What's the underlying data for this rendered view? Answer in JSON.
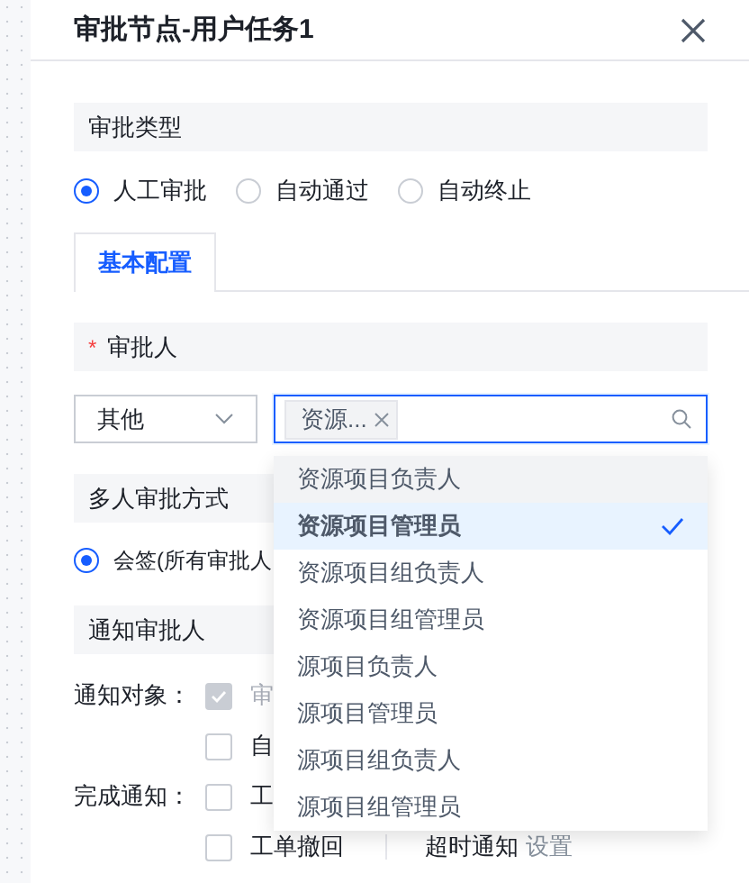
{
  "dialog": {
    "title": "审批节点-用户任务1"
  },
  "approval_type": {
    "label": "审批类型",
    "options": [
      {
        "label": "人工审批",
        "selected": true
      },
      {
        "label": "自动通过",
        "selected": false
      },
      {
        "label": "自动终止",
        "selected": false
      }
    ]
  },
  "tabs": [
    {
      "label": "基本配置",
      "selected": true
    }
  ],
  "approver": {
    "label": "审批人",
    "required_mark": "*",
    "type_select": {
      "value": "其他"
    },
    "picker": {
      "focused": true,
      "tags": [
        "资源..."
      ]
    }
  },
  "multi_approval": {
    "label": "多人审批方式",
    "options": [
      {
        "label": "会签(所有审批人",
        "selected": true
      }
    ]
  },
  "notify": {
    "label": "通知审批人",
    "rows": [
      {
        "label": "通知对象：",
        "checkboxes": [
          {
            "label": "审",
            "checked": true,
            "disabled": true
          }
        ]
      },
      {
        "checkboxes": [
          {
            "label": "自",
            "checked": false,
            "disabled": false
          }
        ]
      },
      {
        "label": "完成通知：",
        "checkboxes": [
          {
            "label": "工",
            "checked": false,
            "disabled": false
          }
        ]
      },
      {
        "checkboxes": [
          {
            "label": "工单撤回",
            "checked": false,
            "disabled": false
          }
        ],
        "extra": "超时通知",
        "link": "设置"
      }
    ]
  },
  "dropdown": {
    "items": [
      {
        "label": "资源项目负责人",
        "selected": false,
        "hovered": true
      },
      {
        "label": "资源项目管理员",
        "selected": true,
        "hovered": false
      },
      {
        "label": "资源项目组负责人",
        "selected": false,
        "hovered": false
      },
      {
        "label": "资源项目组管理员",
        "selected": false,
        "hovered": false
      },
      {
        "label": "源项目负责人",
        "selected": false,
        "hovered": false
      },
      {
        "label": "源项目管理员",
        "selected": false,
        "hovered": false
      },
      {
        "label": "源项目组负责人",
        "selected": false,
        "hovered": false
      },
      {
        "label": "源项目组管理员",
        "selected": false,
        "hovered": false
      }
    ]
  }
}
